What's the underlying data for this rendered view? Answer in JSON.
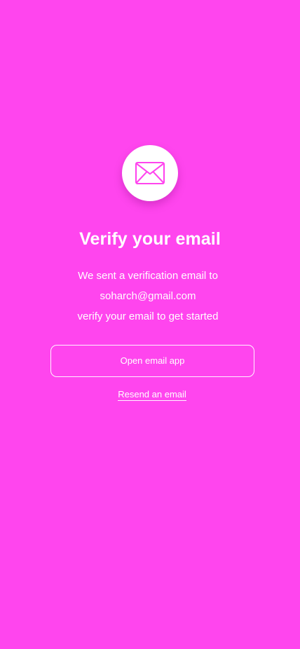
{
  "screen": {
    "background_color": "#ff45ee",
    "icon": "mail-envelope-icon",
    "title": "Verify your email",
    "message_line_1": "We sent a verification email to",
    "email": "soharch@gmail.com",
    "message_line_3": "verify your email to get started",
    "open_email_button_label": "Open email app",
    "resend_link_label": "Resend an email"
  }
}
